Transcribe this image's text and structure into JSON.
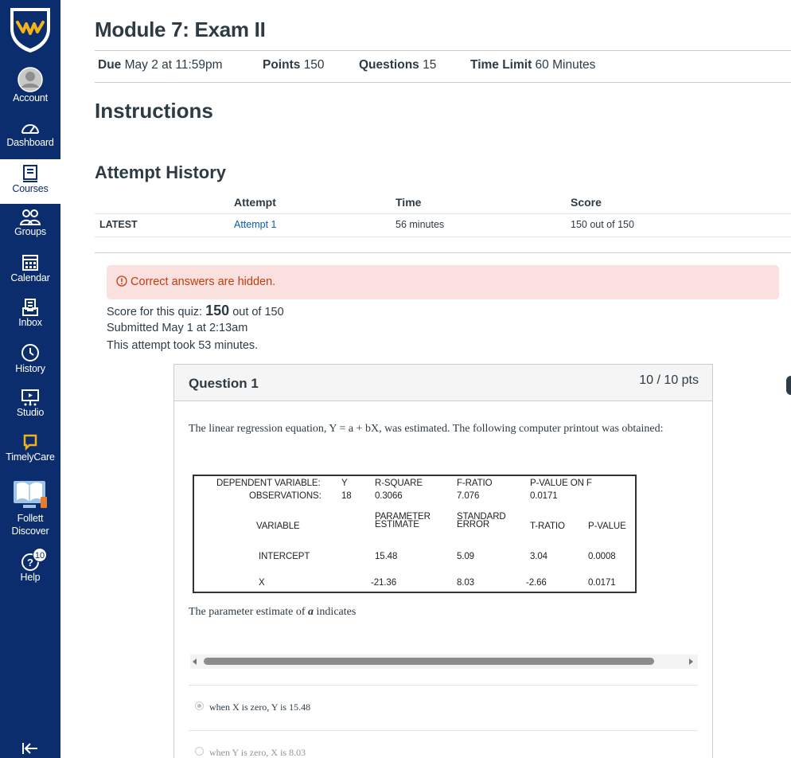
{
  "nav": {
    "items": [
      {
        "label": "Account",
        "icon": "account-icon"
      },
      {
        "label": "Dashboard",
        "icon": "dashboard-icon"
      },
      {
        "label": "Courses",
        "icon": "courses-icon"
      },
      {
        "label": "Groups",
        "icon": "groups-icon"
      },
      {
        "label": "Calendar",
        "icon": "calendar-icon"
      },
      {
        "label": "Inbox",
        "icon": "inbox-icon"
      },
      {
        "label": "History",
        "icon": "history-icon"
      },
      {
        "label": "Studio",
        "icon": "studio-icon"
      },
      {
        "label": "TimelyCare",
        "icon": "timelycare-icon"
      },
      {
        "label_line1": "Follett",
        "label_line2": "Discover",
        "icon": "follett-discover-icon"
      },
      {
        "label": "Help",
        "icon": "help-icon",
        "badge": "10"
      }
    ],
    "colors": {
      "background": "#0b2d6e",
      "logo_gold": "#f2b21b"
    }
  },
  "page": {
    "title": "Module 7: Exam II",
    "meta": {
      "due_label": "Due",
      "due_value": "May 2 at 11:59pm",
      "points_label": "Points",
      "points_value": "150",
      "questions_label": "Questions",
      "questions_value": "15",
      "time_label": "Time Limit",
      "time_value": "60 Minutes"
    },
    "instructions_heading": "Instructions",
    "attempt_history_heading": "Attempt History"
  },
  "attempt_table": {
    "headers": {
      "attempt": "Attempt",
      "time": "Time",
      "score": "Score"
    },
    "row": {
      "tag": "LATEST",
      "attempt": "Attempt 1",
      "time": "56 minutes",
      "score": "150 out of 150"
    }
  },
  "alert": {
    "text": "Correct answers are hidden."
  },
  "summary": {
    "score_prefix": "Score for this quiz:",
    "score_value": "150",
    "score_suffix": "out of 150",
    "submitted": "Submitted May 1 at 2:13am",
    "duration": "This attempt took 53 minutes."
  },
  "question": {
    "title": "Question 1",
    "points": "10 / 10 pts",
    "text": "The linear regression equation, Y = a + bX, was estimated. The following computer printout was obtained:",
    "prompt_before": "The parameter estimate of",
    "prompt_var": "a",
    "prompt_after": "indicates",
    "printout": {
      "dep_var_label": "DEPENDENT VARIABLE:",
      "dep_var_value": "Y",
      "obs_label": "OBSERVATIONS:",
      "obs_value": "18",
      "rsq_label": "R-SQUARE",
      "rsq_value": "0.3066",
      "fratio_label": "F-RATIO",
      "fratio_value": "7.076",
      "pvf_label": "P-VALUE ON F",
      "pvf_value": "0.0171",
      "col_variable": "VARIABLE",
      "col_param_1": "PARAMETER",
      "col_param_2": "ESTIMATE",
      "col_se_1": "STANDARD",
      "col_se_2": "ERROR",
      "col_tratio": "T-RATIO",
      "col_pvalue": "P-VALUE",
      "rows": [
        {
          "variable": "INTERCEPT",
          "estimate": "15.48",
          "se": "5.09",
          "t": "3.04",
          "p": "0.0008"
        },
        {
          "variable": "X",
          "estimate": "-21.36",
          "se": "8.03",
          "t": "-2.66",
          "p": "0.0171"
        }
      ]
    },
    "answers": [
      {
        "text": "when X is zero, Y is 15.48",
        "selected": true
      },
      {
        "text": "when Y is zero, X is 8.03",
        "selected": false
      }
    ]
  }
}
